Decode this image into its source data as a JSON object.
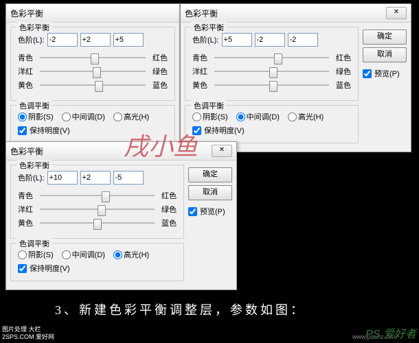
{
  "dialog_title": "色彩平衡",
  "groups": {
    "color_balance": "色彩平衡",
    "tone_balance": "色调平衡"
  },
  "labels": {
    "levels": "色阶(L):",
    "cyan": "青色",
    "red": "红色",
    "magenta": "洋红",
    "green": "绿色",
    "yellow": "黄色",
    "blue": "蓝色",
    "shadows": "阴影(S)",
    "midtones": "中间调(D)",
    "highlights": "高光(H)",
    "preserve_lum": "保持明度(V)",
    "preview": "预览(P)"
  },
  "buttons": {
    "ok": "确定",
    "cancel": "取消",
    "close": "✕"
  },
  "dlg1": {
    "l1": "-2",
    "l2": "+2",
    "l3": "+5",
    "tone": "shadows"
  },
  "dlg2": {
    "l1": "+5",
    "l2": "-2",
    "l3": "-2",
    "tone": "midtones"
  },
  "dlg3": {
    "l1": "+10",
    "l2": "+2",
    "l3": "-5",
    "tone": "highlights"
  },
  "caption": "3、新建色彩平衡调整层，参数如图：",
  "watermark_main": "戌小鱼",
  "watermark_bottom": "PS 爱好者",
  "watermark_url": "www.psahz.com",
  "wm_box_l1": "图片处理 大栏",
  "wm_box_l2": "2SPS.COM 爱好网",
  "chart_data": null
}
